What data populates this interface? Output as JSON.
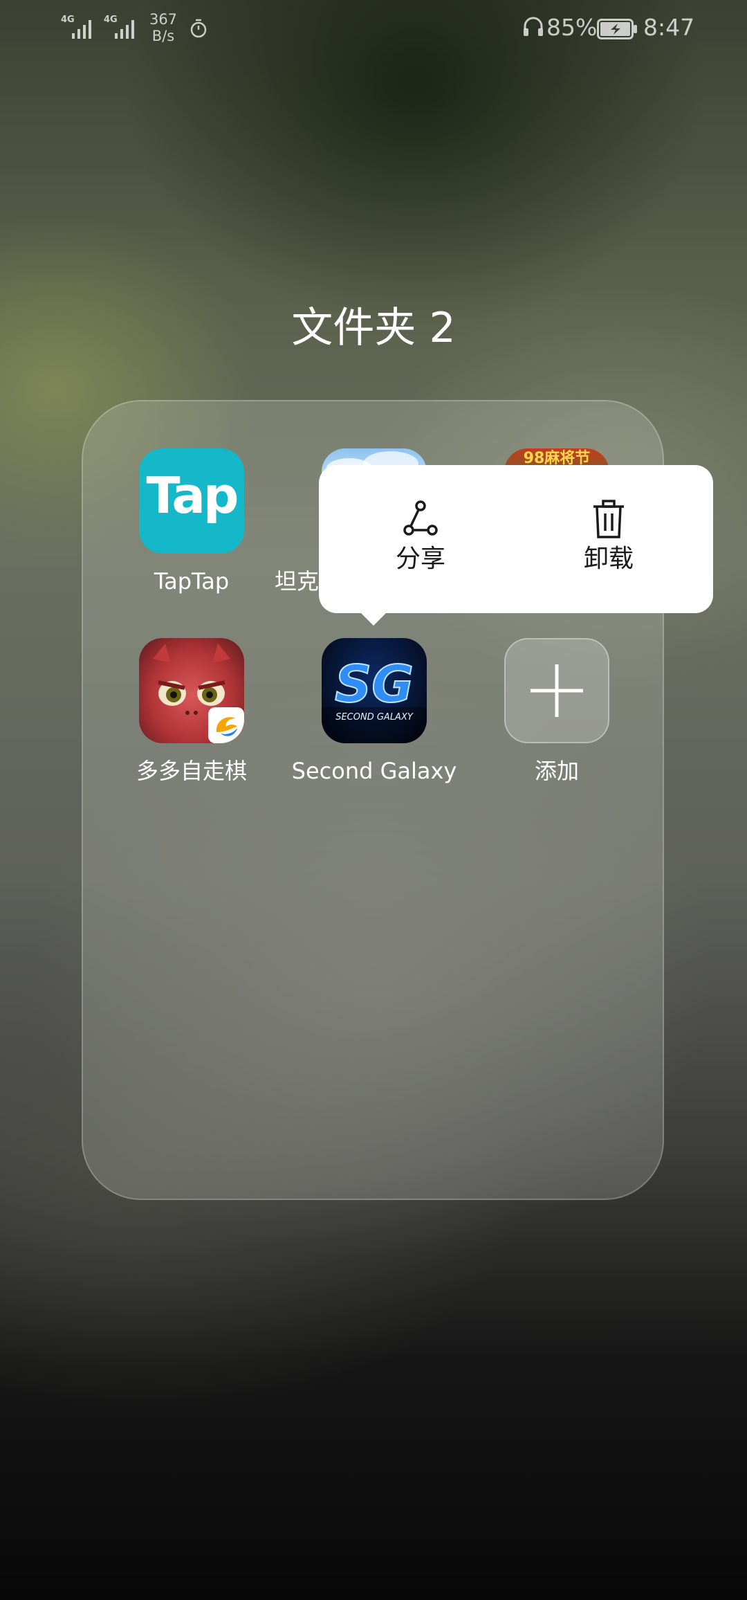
{
  "status_bar": {
    "sim1_network": "4G",
    "sim2_network": "4G",
    "net_speed_value": "367",
    "net_speed_unit": "B/s",
    "battery_percent": "85%",
    "time": "8:47",
    "icons": [
      "signal-icon",
      "timer-icon",
      "headset-icon",
      "battery-charging-icon"
    ]
  },
  "folder": {
    "title": "文件夹 2",
    "apps": [
      {
        "label": "TapTap",
        "icon": "taptap-app-icon",
        "icon_text": "Tap"
      },
      {
        "label": "坦克",
        "icon": "tank-app-icon"
      },
      {
        "label": "",
        "icon": "mahjong-app-icon",
        "icon_text": "98麻将节"
      },
      {
        "label": "多多自走棋",
        "icon": "auto-chess-app-icon"
      },
      {
        "label": "Second Galaxy",
        "icon": "second-galaxy-app-icon",
        "icon_text": "SG",
        "icon_subtext": "SECOND GALAXY"
      },
      {
        "label": "添加",
        "icon": "add-icon"
      }
    ]
  },
  "popup_menu": {
    "items": [
      {
        "label": "分享",
        "icon": "share-icon"
      },
      {
        "label": "卸载",
        "icon": "trash-icon"
      }
    ]
  },
  "colors": {
    "tap_brand": "#14b8c8",
    "popup_bg": "#ffffff",
    "text_light": "#ffffff",
    "text_dark": "#1a1a1a"
  }
}
